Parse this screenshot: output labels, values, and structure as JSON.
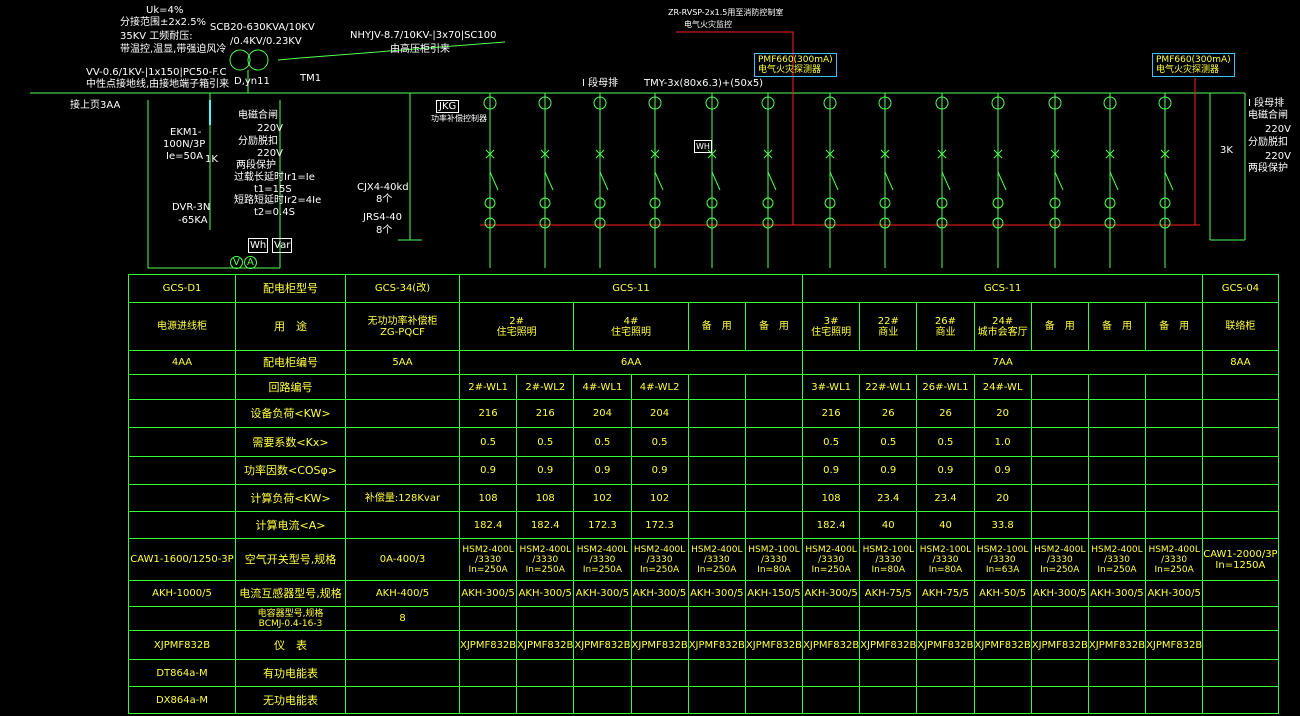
{
  "colors": {
    "bus": "#50ff50",
    "table_line": "#30ff30",
    "text": "#ffff40",
    "label": "#ffffff",
    "fire_line": "#ff2020",
    "box": "#40c0ff"
  },
  "transformer": {
    "uk": "Uk=4%",
    "tap": "分接范围±2x2.5%",
    "volt": "35KV 工频耐压:",
    "protect": "带温控,温显,带强迫风冷",
    "model": "SCB20-630KVA/10KV",
    "ratio": "/0.4KV/0.23KV",
    "group": "D,yn11",
    "tag": "TM1"
  },
  "feeders": {
    "hv_cable": "NHYJV-8.7/10KV-|3x70|SC100",
    "hv_from": "由高压柜引来",
    "pe_cable": "VV-0.6/1KV-|1x150|PC50-F.C",
    "pe_note": "中性点接地线,由接地端子箱引来",
    "incoming": "接上页3AA",
    "fire_cable": "ZR-RVSP-2x1.5用至消防控制室",
    "fire_cable2": "电气火灾监控"
  },
  "busbar": {
    "name": "I 段母排",
    "model": "TMY-3x(80x6.3)+(50x5)"
  },
  "monitors": [
    "PMF660(300mA)",
    "电气火灾探测器",
    "PMF660(300mA)",
    "电气火灾探测器"
  ],
  "incomer": {
    "ekm": "EKM1-",
    "ekm2": "100N/3P",
    "ekm3": "Ie=50A",
    "spd": "DVR-3N",
    "spd2": "-65KA",
    "notes": [
      "电磁合闸",
      "220V",
      "分励脱扣",
      "220V",
      "两段保护",
      "过载长延时Ir1=Ie",
      "t1=15S",
      "短路短延时Ir2=4Ie",
      "t2=0.4S"
    ],
    "k1": "1K",
    "wh": "Wh",
    "var": "Var",
    "amp": "A",
    "volt": "V"
  },
  "capacitor": {
    "jkg": "JKG",
    "jkg_note": "功率补偿控制器",
    "cjx": "CJX4-40kd",
    "cjx_n": "8个",
    "jrs": "JRS4-40",
    "jrs_n": "8个"
  },
  "tie": {
    "bus": "I 段母排",
    "note1": "电磁合闸",
    "v1": "220V",
    "note2": "分励脱扣",
    "v2": "220V",
    "note3": "两段保护",
    "k": "3K"
  },
  "meter_wh": "WH",
  "table": {
    "row_labels": [
      "配电柜型号",
      "用　途",
      "配电柜编号",
      "回路编号",
      "设备负荷<KW>",
      "需要系数<Kx>",
      "功率因数<COSφ>",
      "计算负荷<KW>",
      "计算电流<A>",
      "空气开关型号,规格",
      "电流互感器型号,规格",
      "电容器型号,规格",
      "仪　表",
      "有功电能表",
      "无功电能表"
    ],
    "cap_model": "BCMJ-0.4-16-3",
    "col1": {
      "type": "GCS-D1",
      "use": "电源进线柜",
      "no": "4AA",
      "breaker": "CAW1-1600/1250-3P",
      "ct": "AKH-1000/5",
      "meter": "XJPMF832B",
      "wh": "DT864a-M",
      "var": "DX864a-M"
    },
    "col3": {
      "type": "GCS-34(改)",
      "use1": "无功功率补偿柜",
      "use2": "ZG-PQCF",
      "no": "5AA",
      "calc": "补偿量:128Kvar",
      "breaker": "0A-400/3",
      "ct": "AKH-400/5",
      "cap": "8"
    },
    "grp6": {
      "type": "GCS-11",
      "no": "6AA"
    },
    "grp7": {
      "type": "GCS-11",
      "no": "7AA"
    },
    "colE": {
      "type": "GCS-04",
      "use": "联络柜",
      "no": "8AA",
      "breaker1": "CAW1-2000/3P",
      "breaker2": "In=1250A"
    },
    "uses6": [
      [
        "2#",
        "住宅照明"
      ],
      [
        "4#",
        "住宅照明"
      ],
      [
        "",
        "备　用"
      ],
      [
        "",
        "备　用"
      ]
    ],
    "uses7": [
      [
        "3#",
        "住宅照明"
      ],
      [
        "22#",
        "商业"
      ],
      [
        "26#",
        "商业"
      ],
      [
        "24#",
        "城市会客厅"
      ],
      [
        "",
        "备　用"
      ],
      [
        "",
        "备　用"
      ],
      [
        "",
        "备　用"
      ]
    ],
    "circuits": [
      "2#-WL1",
      "2#-WL2",
      "4#-WL1",
      "4#-WL2",
      "",
      "",
      "3#-WL1",
      "22#-WL1",
      "26#-WL1",
      "24#-WL",
      "",
      "",
      ""
    ],
    "load": [
      "216",
      "216",
      "204",
      "204",
      "",
      "",
      "216",
      "26",
      "26",
      "20",
      "",
      "",
      ""
    ],
    "kx": [
      "0.5",
      "0.5",
      "0.5",
      "0.5",
      "",
      "",
      "0.5",
      "0.5",
      "0.5",
      "1.0",
      "",
      "",
      ""
    ],
    "cos": [
      "0.9",
      "0.9",
      "0.9",
      "0.9",
      "",
      "",
      "0.9",
      "0.9",
      "0.9",
      "0.9",
      "",
      "",
      ""
    ],
    "pc": [
      "108",
      "108",
      "102",
      "102",
      "",
      "",
      "108",
      "23.4",
      "23.4",
      "20",
      "",
      "",
      ""
    ],
    "ic": [
      "182.4",
      "182.4",
      "172.3",
      "172.3",
      "",
      "",
      "182.4",
      "40",
      "40",
      "33.8",
      "",
      "",
      ""
    ],
    "brk_model": [
      "HSM2-400L",
      "HSM2-400L",
      "HSM2-400L",
      "HSM2-400L",
      "HSM2-400L",
      "HSM2-100L",
      "HSM2-400L",
      "HSM2-100L",
      "HSM2-100L",
      "HSM2-100L",
      "HSM2-400L",
      "HSM2-400L",
      "HSM2-400L"
    ],
    "brk_frame": [
      "/3330",
      "/3330",
      "/3330",
      "/3330",
      "/3330",
      "/3330",
      "/3330",
      "/3330",
      "/3330",
      "/3330",
      "/3330",
      "/3330",
      "/3330"
    ],
    "brk_in": [
      "In=250A",
      "In=250A",
      "In=250A",
      "In=250A",
      "In=250A",
      "In=80A",
      "In=250A",
      "In=80A",
      "In=80A",
      "In=63A",
      "In=250A",
      "In=250A",
      "In=250A"
    ],
    "ct": [
      "AKH-300/5",
      "AKH-300/5",
      "AKH-300/5",
      "AKH-300/5",
      "AKH-300/5",
      "AKH-150/5",
      "AKH-300/5",
      "AKH-75/5",
      "AKH-75/5",
      "AKH-50/5",
      "AKH-300/5",
      "AKH-300/5",
      "AKH-300/5"
    ],
    "meter": [
      "XJPMF832B",
      "XJPMF832B",
      "XJPMF832B",
      "XJPMF832B",
      "XJPMF832B",
      "XJPMF832B",
      "XJPMF832B",
      "XJPMF832B",
      "XJPMF832B",
      "XJPMF832B",
      "XJPMF832B",
      "XJPMF832B",
      "XJPMF832B"
    ]
  }
}
